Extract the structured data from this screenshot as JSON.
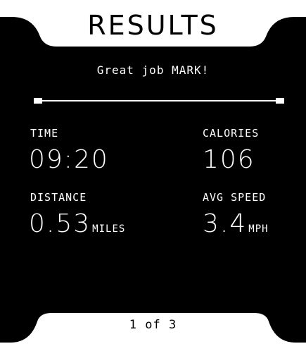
{
  "screen": {
    "title": "RESULTS",
    "greeting": "Great job MARK!",
    "background_color": "#000000",
    "foreground_color": "#ffffff"
  },
  "stats": {
    "time": {
      "label": "TIME",
      "value": "09:20",
      "unit": ""
    },
    "calories": {
      "label": "CALORIES",
      "value": "106",
      "unit": ""
    },
    "distance": {
      "label": "DISTANCE",
      "value": "0.53",
      "unit": "MILES"
    },
    "avg_speed": {
      "label": "AVG SPEED",
      "value": "3.4",
      "unit": "MPH"
    }
  },
  "pagination": {
    "text": "1 of 3"
  }
}
